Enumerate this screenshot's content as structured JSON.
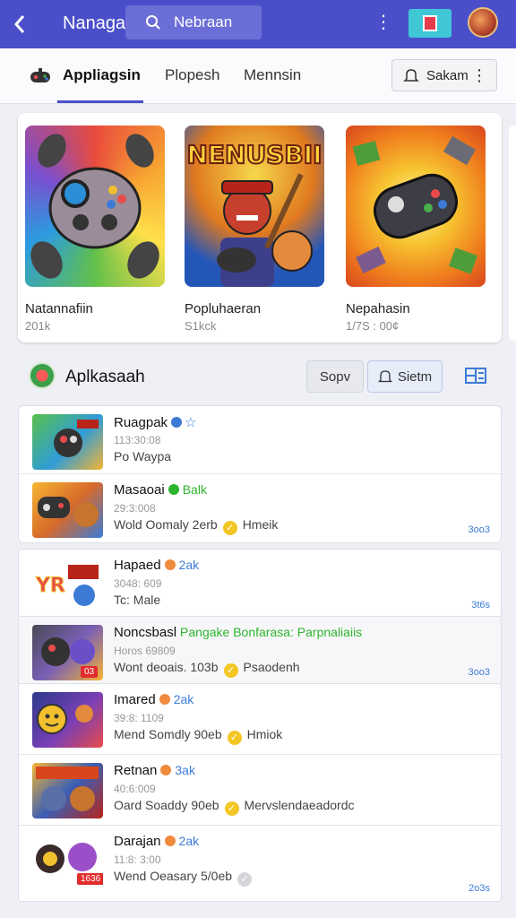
{
  "appbar": {
    "back_icon": "chevron-left-icon",
    "title": "Nanagai",
    "search_placeholder": "Nebraan",
    "kebab": "⋮",
    "colors": {
      "bar": "#4a4fc9",
      "search": "#6a6ed6",
      "gift_bg": "#3fc7d6"
    }
  },
  "tabs": {
    "items": [
      {
        "label": "Appliagsin",
        "active": true
      },
      {
        "label": "Plopesh",
        "active": false
      },
      {
        "label": "Mennsin",
        "active": false
      }
    ],
    "share_label": "Sakam",
    "share_more": "⋮"
  },
  "featured": [
    {
      "name": "Natannafiin",
      "sub": "201k",
      "art": "controller"
    },
    {
      "name": "Popluhaeran",
      "sub": "S1kck",
      "art_title": "NENUSBII",
      "art": "hero"
    },
    {
      "name": "Nepahasin",
      "sub": "1/7S : 00¢",
      "art": "gamepad"
    }
  ],
  "section": {
    "title": "Aplkasaah",
    "sort_label": "Sopv",
    "filter_label": "Sietm"
  },
  "list": [
    {
      "title": "Ruagpak",
      "tag": "",
      "dot": "#3b7bd6",
      "star": "☆",
      "meta": "113:30:08",
      "desc": "Po Waypa",
      "check": "",
      "count": "",
      "badge": "",
      "art": "a"
    },
    {
      "title": "Masaoai",
      "tag": "Balk",
      "tag_color": "#2db52d",
      "dot": "#2db52d",
      "meta": "29:3:008",
      "desc": "Wold Oomaly 2erb",
      "check": "✓",
      "extra": "Hmeik",
      "count": "3oo3",
      "badge": "",
      "art": "b"
    },
    {
      "title": "Hapaed",
      "tag": "2ak",
      "tag_color": "#3b7bd6",
      "dot": "#f08a3c",
      "meta": "3048: 609",
      "desc": "Tc: Male",
      "check": "",
      "count": "3t6s",
      "badge": "",
      "art": "c"
    },
    {
      "title": "Noncsbasl",
      "tag": "Pangake Bonfarasa: Parpnaliaiis",
      "tag_color": "#2db52d",
      "dot": "#2db52d",
      "meta": "Horos 69809",
      "desc": "Wont deoais. 103b",
      "check": "✓",
      "extra": "Psaodenh",
      "count": "3oo3",
      "badge": "03",
      "art": "d",
      "highlight": true
    },
    {
      "title": "Imared",
      "tag": "2ak",
      "tag_color": "#3b7bd6",
      "dot": "#f08a3c",
      "meta": "39:8: 1109",
      "desc": "Mend Somdly 90eb",
      "check": "✓",
      "extra": "Hmiok",
      "count": "",
      "badge": "",
      "art": "e"
    },
    {
      "title": "Retnan",
      "tag": "3ak",
      "tag_color": "#3b7bd6",
      "dot": "#f08a3c",
      "meta": "40:6:009",
      "desc": "Oard Soaddy 90eb",
      "check": "✓",
      "extra": "Mervslendaeadordc",
      "count": "",
      "badge": "",
      "art": "f"
    },
    {
      "title": "Darajan",
      "tag": "2ak",
      "tag_color": "#3b7bd6",
      "dot": "#f08a3c",
      "meta": "11:8: 3:00",
      "desc": "Wend Oeasary 5/0eb",
      "check": "✓",
      "check_grey": true,
      "extra": "",
      "count": "2o3s",
      "badge": "1636",
      "art": "g"
    }
  ]
}
